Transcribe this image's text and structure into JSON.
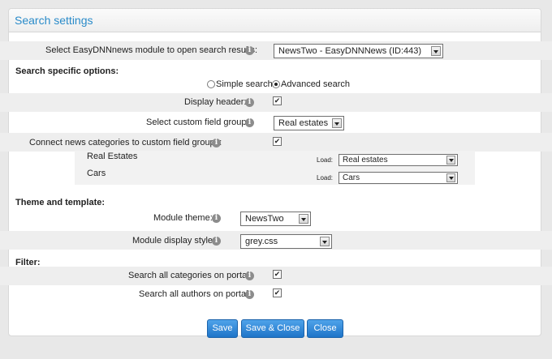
{
  "panel": {
    "title": "Search settings"
  },
  "module": {
    "label": "Select EasyDNNnews module to open search results:",
    "value": "NewsTwo - EasyDNNNews (ID:443)"
  },
  "search_options": {
    "heading": "Search specific options:",
    "simple_label": "Simple search",
    "advanced_label": "Advanced search",
    "selected": "advanced",
    "display_header_label": "Display header:",
    "display_header_checked": true,
    "custom_field_group_label": "Select custom field group:",
    "custom_field_group_value": "Real estates",
    "connect_label": "Connect news categories to custom field groups:",
    "connect_checked": true,
    "mappings": [
      {
        "category": "Real Estates",
        "load_label": "Load:",
        "value": "Real estates"
      },
      {
        "category": "Cars",
        "load_label": "Load:",
        "value": "Cars"
      }
    ]
  },
  "theme": {
    "heading": "Theme and template:",
    "module_theme_label": "Module theme:",
    "module_theme_value": "NewsTwo",
    "display_style_label": "Module display style:",
    "display_style_value": "grey.css"
  },
  "filter": {
    "heading": "Filter:",
    "all_categories_label": "Search all categories on portal:",
    "all_categories_checked": true,
    "all_authors_label": "Search all authors on portal:",
    "all_authors_checked": true
  },
  "buttons": {
    "save": "Save",
    "save_close": "Save & Close",
    "close": "Close"
  },
  "icons": {
    "info": "info-icon",
    "check": "✔",
    "dropdown": "chevron-down-icon"
  },
  "colors": {
    "title": "#2a8bc9",
    "button": "#2c84d6"
  }
}
